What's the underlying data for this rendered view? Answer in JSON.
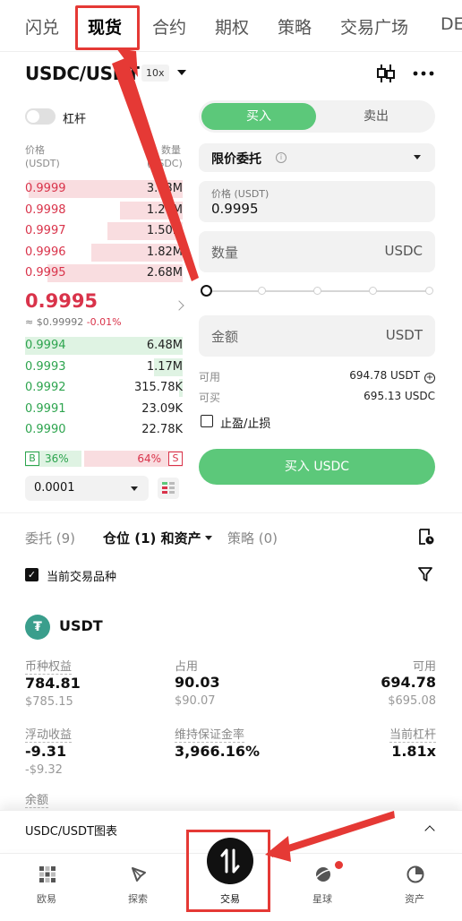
{
  "top_tabs": [
    {
      "label": "闪兑",
      "active": false
    },
    {
      "label": "现货",
      "active": true
    },
    {
      "label": "合约",
      "active": false
    },
    {
      "label": "期权",
      "active": false
    },
    {
      "label": "策略",
      "active": false
    },
    {
      "label": "交易广场",
      "active": false
    },
    {
      "label": "DE",
      "active": false
    }
  ],
  "pair": {
    "name": "USDC/USDT",
    "leverage": "10x"
  },
  "margin_toggle": {
    "label": "杠杆",
    "on": false
  },
  "orderbook": {
    "price_header": "价格",
    "price_unit": "(USDT)",
    "qty_header": "数量",
    "qty_unit": "(USDC)",
    "asks": [
      {
        "price": "0.9999",
        "qty": "3.13M",
        "depth": 0.98
      },
      {
        "price": "0.9998",
        "qty": "1.27M",
        "depth": 0.4
      },
      {
        "price": "0.9997",
        "qty": "1.50M",
        "depth": 0.48
      },
      {
        "price": "0.9996",
        "qty": "1.82M",
        "depth": 0.58
      },
      {
        "price": "0.9995",
        "qty": "2.68M",
        "depth": 0.86
      }
    ],
    "last_price": "0.9995",
    "last_usd": "≈ $0.99992",
    "last_change": "-0.01%",
    "bids": [
      {
        "price": "0.9994",
        "qty": "6.48M",
        "depth": 1.0
      },
      {
        "price": "0.9993",
        "qty": "1.17M",
        "depth": 0.18
      },
      {
        "price": "0.9992",
        "qty": "315.78K",
        "depth": 0.02
      },
      {
        "price": "0.9991",
        "qty": "23.09K",
        "depth": 0.0
      },
      {
        "price": "0.9990",
        "qty": "22.78K",
        "depth": 0.0
      }
    ],
    "buy_ratio_tag": "B",
    "buy_ratio": "36%",
    "sell_ratio": "64%",
    "sell_ratio_tag": "S",
    "precision": "0.0001"
  },
  "order_form": {
    "buy_tab": "买入",
    "sell_tab": "卖出",
    "order_type": "限价委托",
    "price_label": "价格 (USDT)",
    "price_value": "0.9995",
    "qty_placeholder": "数量",
    "qty_unit": "USDC",
    "amount_placeholder": "金额",
    "amount_unit": "USDT",
    "available_label": "可用",
    "available_value": "694.78 USDT",
    "can_buy_label": "可买",
    "can_buy_value": "695.13 USDC",
    "tpsl_label": "止盈/止损",
    "submit_label": "买入 USDC"
  },
  "section_tabs": {
    "orders": "委托 (9)",
    "positions": "仓位 (1) 和资产",
    "strategies": "策略 (0)"
  },
  "current_filter": "当前交易品种",
  "asset": {
    "coin": "USDT",
    "coin_symbol": "₮",
    "equity_label": "币种权益",
    "equity": "784.81",
    "equity_usd": "$785.15",
    "used_label": "占用",
    "used": "90.03",
    "used_usd": "$90.07",
    "avail_label": "可用",
    "avail": "694.78",
    "avail_usd": "$695.08",
    "upnl_label": "浮动收益",
    "upnl": "-9.31",
    "upnl_usd": "-$9.32",
    "mmr_label": "维持保证金率",
    "mmr": "3,966.16%",
    "lev_label": "当前杠杆",
    "lev": "1.81x",
    "balance_label": "余额"
  },
  "chart_bar": {
    "label": "USDC/USDT图表"
  },
  "bottom_nav": [
    {
      "label": "欧易",
      "icon": "okx-logo-icon"
    },
    {
      "label": "探索",
      "icon": "compass-icon"
    },
    {
      "label": "交易",
      "icon": "trade-swap-icon",
      "active": true
    },
    {
      "label": "星球",
      "icon": "planet-icon",
      "badge": true
    },
    {
      "label": "资产",
      "icon": "pie-chart-icon"
    }
  ],
  "colors": {
    "buy": "#5cc87a",
    "ask": "#d9334a",
    "bid": "#2da44e",
    "annotation": "#e53935"
  }
}
